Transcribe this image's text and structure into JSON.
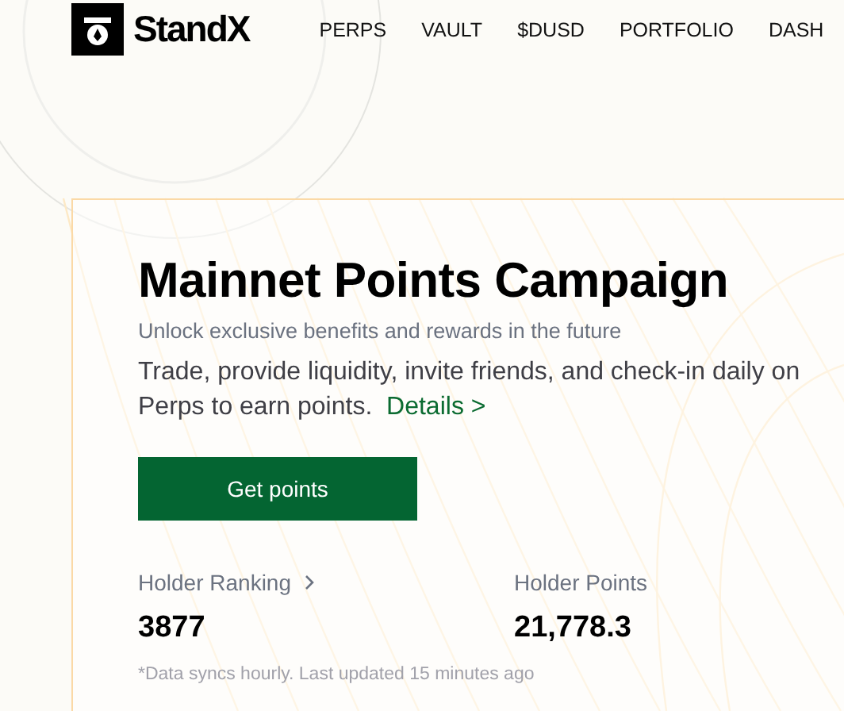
{
  "header": {
    "brand": "StandX",
    "nav": [
      {
        "label": "PERPS"
      },
      {
        "label": "VAULT"
      },
      {
        "label": "$DUSD"
      },
      {
        "label": "PORTFOLIO"
      },
      {
        "label": "DASH"
      }
    ]
  },
  "campaign": {
    "title": "Mainnet Points Campaign",
    "subtitle": "Unlock exclusive benefits and rewards in the future",
    "description": "Trade, provide liquidity, invite friends, and check-in daily on Perps to earn points.",
    "details_link": "Details >",
    "button": "Get points",
    "stats": [
      {
        "label": "Holder Ranking",
        "has_chevron": true,
        "value": "3877"
      },
      {
        "label": "Holder Points",
        "has_chevron": false,
        "value": "21,778.3"
      }
    ],
    "footnote": "*Data syncs hourly. Last updated 15 minutes ago"
  }
}
